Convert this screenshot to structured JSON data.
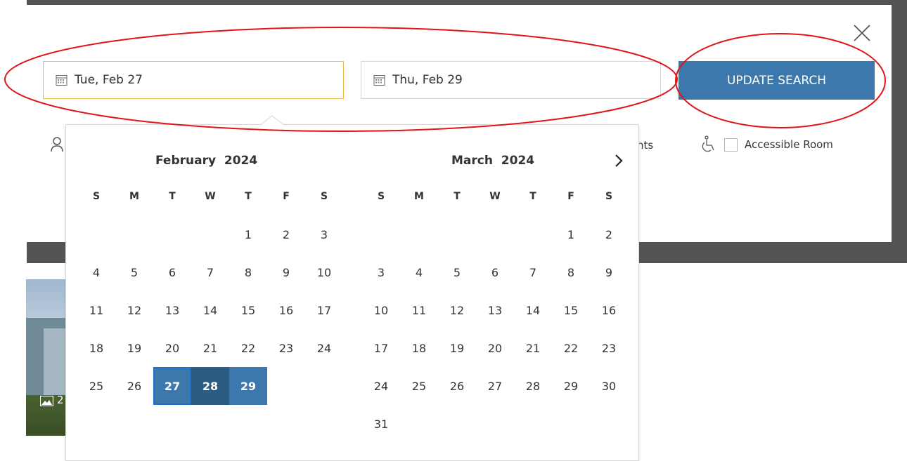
{
  "search_form": {
    "checkin_value": "Tue, Feb 27",
    "checkout_value": "Thu, Feb 29",
    "update_button_label": "UPDATE SEARCH",
    "promo_partial_text": "nts",
    "accessible_room_label": "Accessible Room",
    "accessible_room_checked": false
  },
  "hotel_card": {
    "photo_count_partial": "2"
  },
  "calendar": {
    "weekday_labels": [
      "S",
      "M",
      "T",
      "W",
      "T",
      "F",
      "S"
    ],
    "months": [
      {
        "month": "February",
        "year": "2024",
        "first_weekday_index": 4,
        "days_in_month": 29
      },
      {
        "month": "March",
        "year": "2024",
        "first_weekday_index": 5,
        "days_in_month": 31
      }
    ],
    "selected_range": {
      "start": 27,
      "end": 29,
      "month_index": 0
    }
  },
  "colors": {
    "primary_blue": "#3d78ad",
    "range_dark_blue": "#2d5b82",
    "active_field_border": "#f2b94a",
    "annotation_red": "#e0141b",
    "overlay_frame": "#545454"
  },
  "icons": {
    "close": "close-icon",
    "calendar": "calendar-icon",
    "guest": "person-icon",
    "wheelchair": "wheelchair-icon",
    "next_month": "chevron-right-icon",
    "photo": "photo-icon"
  }
}
